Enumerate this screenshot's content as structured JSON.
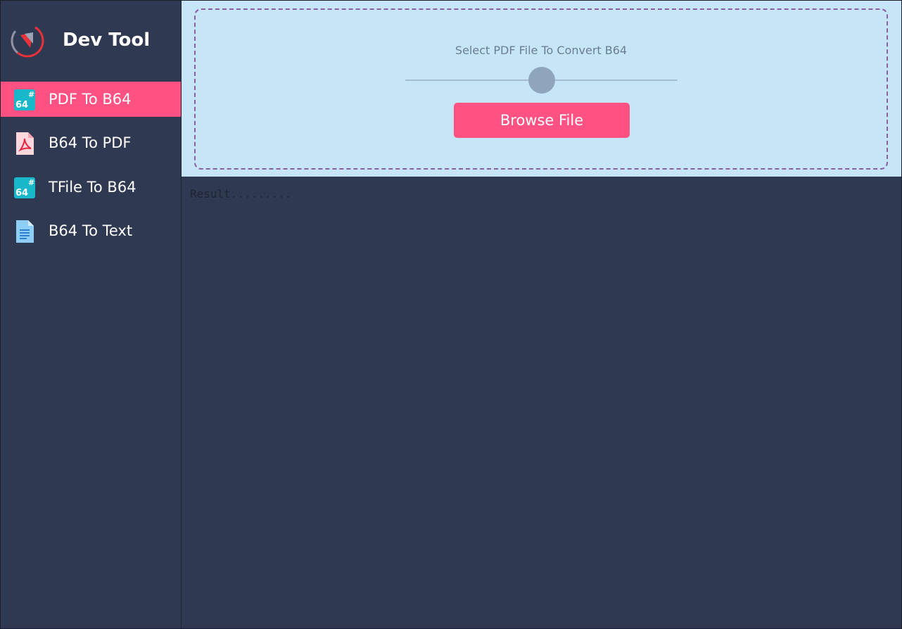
{
  "app": {
    "title": "Dev Tool",
    "accent_color": "#ff5283",
    "sidebar_bg": "#303952",
    "panel_bg": "#c6e5f7"
  },
  "sidebar": {
    "items": [
      {
        "label": "PDF To B64",
        "icon": "base64-icon",
        "active": true
      },
      {
        "label": "B64 To PDF",
        "icon": "pdf-file-icon",
        "active": false
      },
      {
        "label": "TFile To B64",
        "icon": "base64-icon",
        "active": false
      },
      {
        "label": "B64 To Text",
        "icon": "text-file-icon",
        "active": false
      }
    ]
  },
  "upload": {
    "label": "Select PDF File To Convert B64",
    "browse_label": "Browse File",
    "slider_value": 0.5
  },
  "result": {
    "placeholder": "Result.........",
    "value": ""
  }
}
